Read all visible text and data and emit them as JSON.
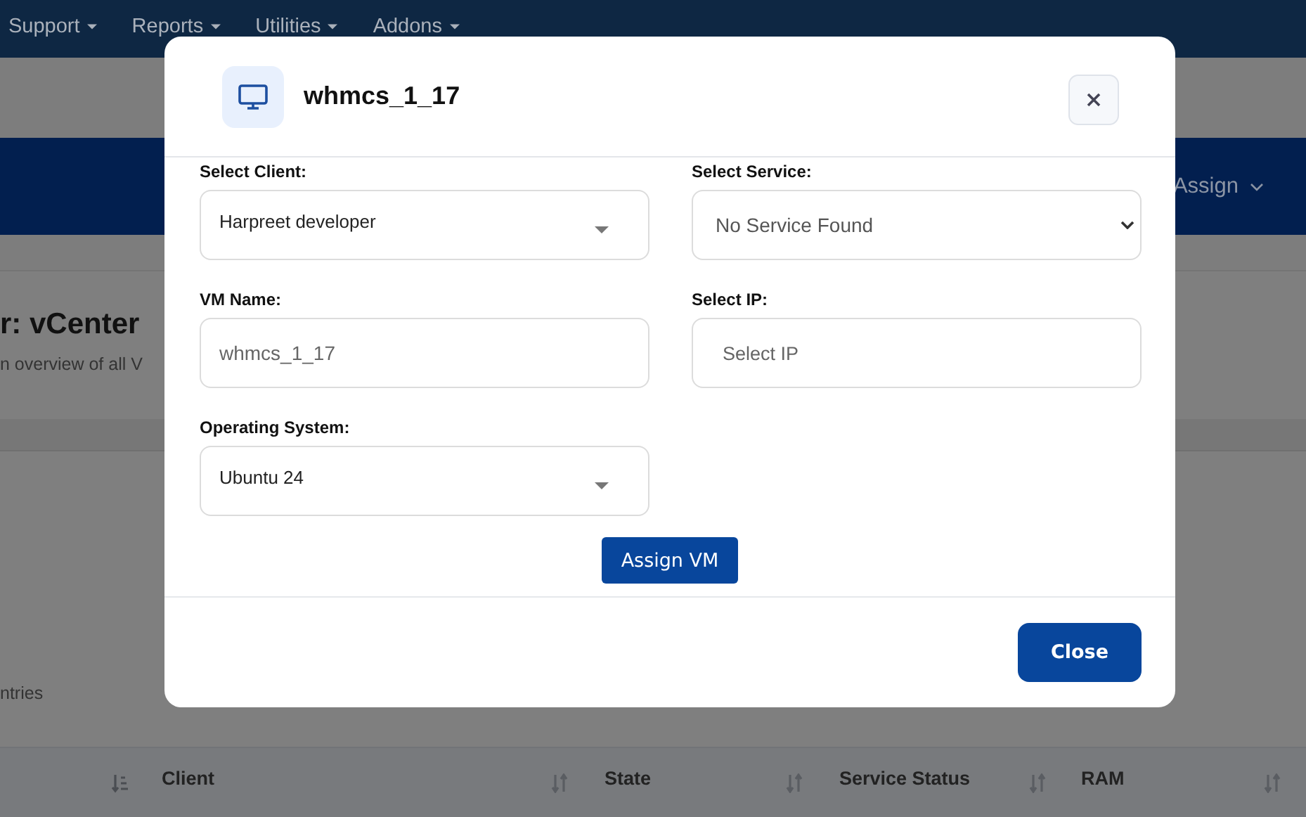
{
  "nav": {
    "items": [
      "Support",
      "Reports",
      "Utilities",
      "Addons"
    ]
  },
  "toolbar": {
    "items": [
      "Assign"
    ]
  },
  "page": {
    "title": "r: vCenter",
    "subtitle": "n overview of all V",
    "entries_text": "ntries"
  },
  "table": {
    "columns": [
      {
        "label": "Client"
      },
      {
        "label": "State"
      },
      {
        "label": "Service Status"
      },
      {
        "label": "RAM"
      }
    ]
  },
  "modal": {
    "title": "whmcs_1_17",
    "fields": [
      {
        "label": "Select Client:",
        "kind": "dropdown",
        "value": "Harpreet developer"
      },
      {
        "label": "Select Service:",
        "kind": "select",
        "value": "No Service Found"
      },
      {
        "label": "VM Name:",
        "kind": "input",
        "value": "whmcs_1_17"
      },
      {
        "label": "Select IP:",
        "kind": "input",
        "placeholder": "Select IP"
      },
      {
        "label": "Operating System:",
        "kind": "dropdown",
        "value": "Ubuntu 24"
      }
    ],
    "submit": "Assign VM",
    "footer_button": "Close"
  }
}
